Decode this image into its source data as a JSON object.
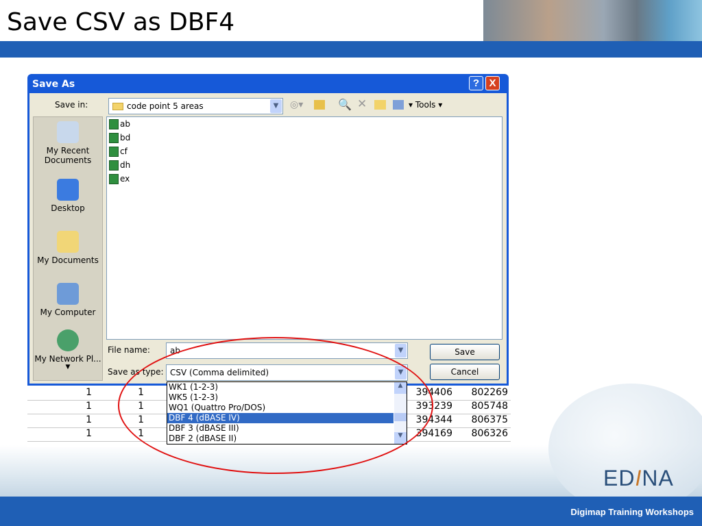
{
  "slide": {
    "title": "Save CSV as DBF4",
    "footer": "Digimap Training Workshops",
    "logo": "EDINA"
  },
  "dialog": {
    "title": "Save As",
    "help": "?",
    "close": "X",
    "save_in_label": "Save in:",
    "save_in_value": "code point 5 areas",
    "tools_label": "Tools",
    "places": [
      "My Recent Documents",
      "Desktop",
      "My Documents",
      "My Computer",
      "My Network Pl..."
    ],
    "files": [
      "ab",
      "bd",
      "cf",
      "dh",
      "ex"
    ],
    "file_name_label": "File name:",
    "file_name_value": "ab",
    "type_label": "Save as type:",
    "type_value": "CSV (Comma delimited)",
    "save_button": "Save",
    "cancel_button": "Cancel",
    "type_options": [
      "WK1 (1-2-3)",
      "WK5 (1-2-3)",
      "WQ1 (Quattro Pro/DOS)",
      "DBF 4 (dBASE IV)",
      "DBF 3 (dBASE III)",
      "DBF 2 (dBASE II)"
    ],
    "selected_option": "DBF 4 (dBASE IV)"
  },
  "sheet": {
    "rows": [
      [
        "1",
        "1",
        "394406",
        "802269"
      ],
      [
        "1",
        "1",
        "393239",
        "805748"
      ],
      [
        "1",
        "1",
        "394344",
        "806375"
      ],
      [
        "1",
        "1",
        "394169",
        "806326"
      ]
    ]
  }
}
